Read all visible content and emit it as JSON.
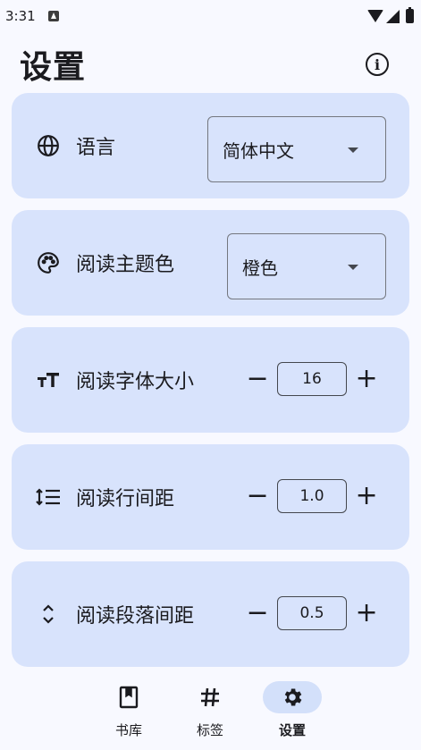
{
  "status_bar": {
    "time": "3:31"
  },
  "header": {
    "title": "设置",
    "info_icon": "info-icon"
  },
  "settings": {
    "language": {
      "icon": "globe-icon",
      "label": "语言",
      "value": "简体中文"
    },
    "theme": {
      "icon": "palette-icon",
      "label": "阅读主题色",
      "value": "橙色"
    },
    "font_size": {
      "icon": "text-size-icon",
      "label": "阅读字体大小",
      "value": "16",
      "minus": "−",
      "plus": "+"
    },
    "line_spacing": {
      "icon": "line-spacing-icon",
      "label": "阅读行间距",
      "value": "1.0",
      "minus": "−",
      "plus": "+"
    },
    "paragraph_spacing": {
      "icon": "expand-vertical-icon",
      "label": "阅读段落间距",
      "value": "0.5",
      "minus": "−",
      "plus": "+"
    }
  },
  "bottom_nav": [
    {
      "icon": "book-icon",
      "label": "书库",
      "active": false
    },
    {
      "icon": "hashtag-icon",
      "label": "标签",
      "active": false
    },
    {
      "icon": "gear-icon",
      "label": "设置",
      "active": true
    }
  ],
  "colors": {
    "card_bg": "#d8e3fc",
    "page_bg": "#f8f9ff",
    "nav_active_bg": "#d3e0fa"
  }
}
